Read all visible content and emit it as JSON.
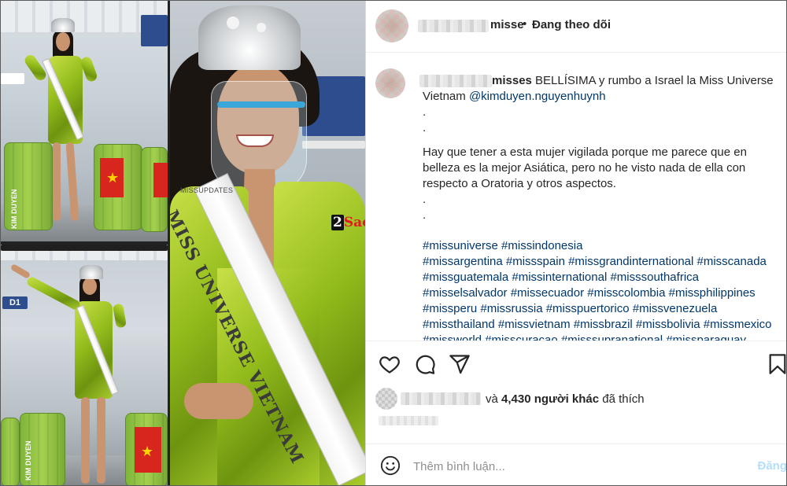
{
  "collage": {
    "watermark_num": "2",
    "watermark_word": "Sao",
    "photo_credit": "MISSUPDATES",
    "sash_text": "MISS UNIVERSE VIETNAM",
    "suitcase_label": "KIM DUYEN",
    "gate_sign": "D1"
  },
  "header": {
    "username": "misse",
    "separator": "•",
    "follow_label": "Đang theo dõi",
    "more_icon": "more-options-icon"
  },
  "caption": {
    "username": "misses",
    "text_line1": " BELLÍSIMA y rumbo a Israel la Miss Universe Vietnam ",
    "mention": "@kimduyen.nguyenhuynh",
    "dot1": ".",
    "dot2": ".",
    "paragraph": "Hay que tener a esta mujer vigilada porque me parece que en belleza es la mejor Asiática, pero no he visto nada de ella con respecto a Oratoria y otros aspectos.",
    "dot3": ".",
    "dot4": ".",
    "hashtags": [
      "#missuniverse #missindonesia",
      "#missargentina #missspain #missgrandinternational #misscanada",
      "#missguatemala #missinternational #misssouthafrica",
      "#misselsalvador #missecuador #misscolombia #missphilippines",
      "#missperu #missrussia #misspuertorico #missvenezuela",
      "#missthailand #missvietnam #missbrazil #missbolivia #missmexico",
      "#missworld #misscuracao #misssupranational #missparaguay"
    ]
  },
  "actions": {
    "like_icon": "heart-icon",
    "comment_icon": "comment-icon",
    "share_icon": "share-icon",
    "save_icon": "bookmark-icon"
  },
  "likes": {
    "prefix": "và ",
    "count": "4,430 người khác",
    "suffix": " đã thích"
  },
  "comment": {
    "placeholder": "Thêm bình luận...",
    "post_label": "Đăng"
  }
}
